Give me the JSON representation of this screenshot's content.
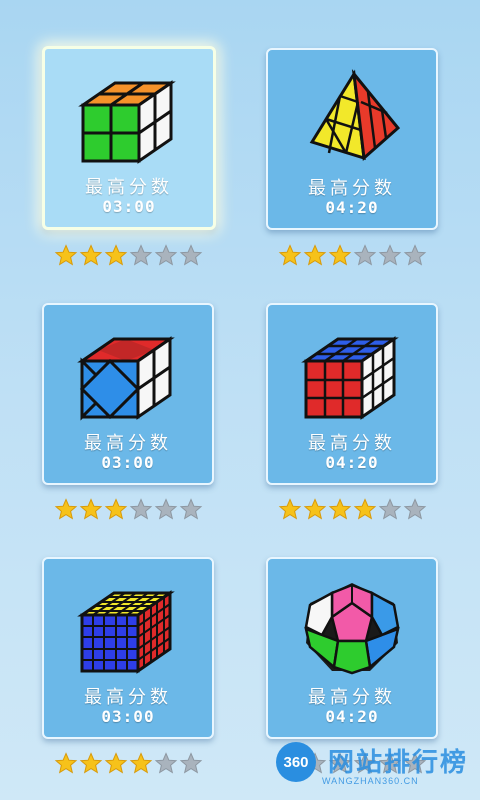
{
  "levels": [
    {
      "name": "cube-2x2",
      "label": "最高分数",
      "time": "03:00",
      "stars": 3,
      "selected": true
    },
    {
      "name": "pyraminx",
      "label": "最高分数",
      "time": "04:20",
      "stars": 3,
      "selected": false
    },
    {
      "name": "skewb",
      "label": "最高分数",
      "time": "03:00",
      "stars": 3,
      "selected": false
    },
    {
      "name": "cube-3x3",
      "label": "最高分数",
      "time": "04:20",
      "stars": 4,
      "selected": false
    },
    {
      "name": "cube-5x5",
      "label": "最高分数",
      "time": "03:00",
      "stars": 4,
      "selected": false
    },
    {
      "name": "megaminx",
      "label": "最高分数",
      "time": "04:20",
      "stars": 1,
      "selected": false
    }
  ],
  "max_stars": 6,
  "colors": {
    "star_on": "#f6c21a",
    "star_off": "#a9b3bd",
    "card": "#6bb8e8"
  },
  "watermark": {
    "badge": "360",
    "title": "网站排行榜",
    "subtitle": "WANGZHAN360.CN"
  }
}
